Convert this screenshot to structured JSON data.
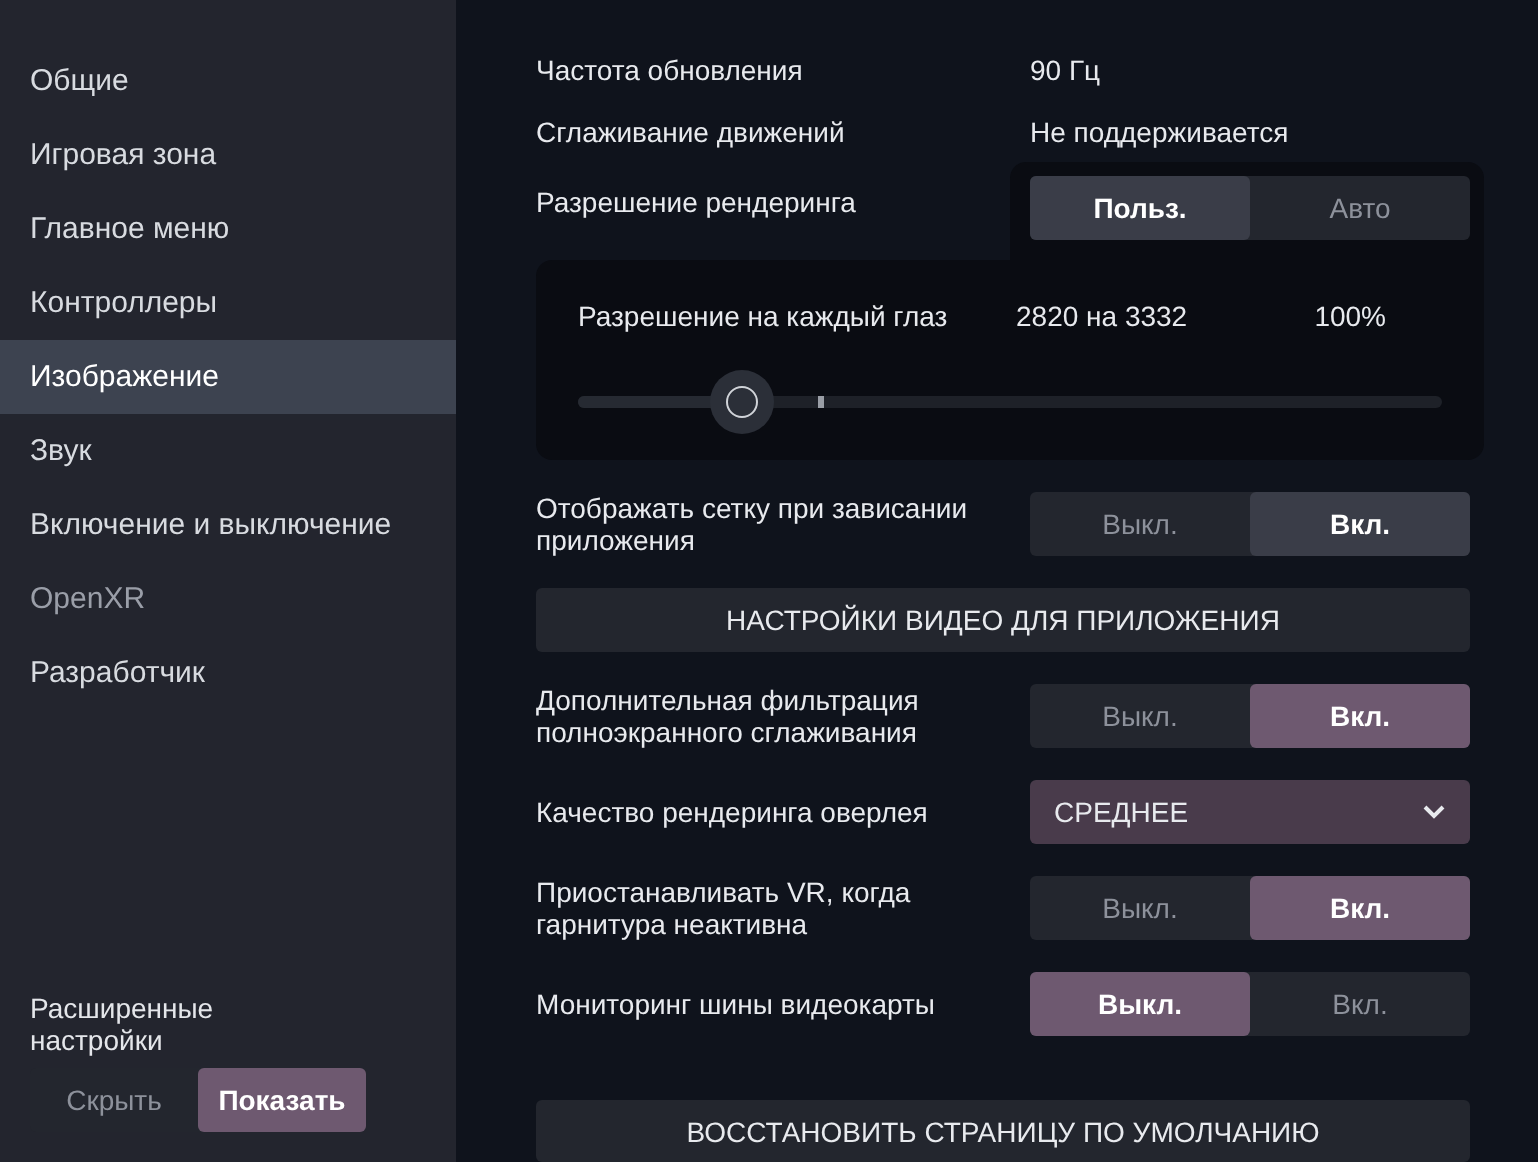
{
  "sidebar": {
    "items": [
      {
        "label": "Общие",
        "selected": false,
        "disabled": false
      },
      {
        "label": "Игровая зона",
        "selected": false,
        "disabled": false
      },
      {
        "label": "Главное меню",
        "selected": false,
        "disabled": false
      },
      {
        "label": "Контроллеры",
        "selected": false,
        "disabled": false
      },
      {
        "label": "Изображение",
        "selected": true,
        "disabled": false
      },
      {
        "label": "Звук",
        "selected": false,
        "disabled": false
      },
      {
        "label": "Включение и выключение",
        "selected": false,
        "disabled": false
      },
      {
        "label": "OpenXR",
        "selected": false,
        "disabled": true
      },
      {
        "label": "Разработчик",
        "selected": false,
        "disabled": false
      }
    ],
    "advanced": {
      "label": "Расширенные настройки",
      "options": [
        {
          "label": "Скрыть",
          "selected": false
        },
        {
          "label": "Показать",
          "selected": true
        }
      ]
    }
  },
  "info_rows": [
    {
      "label": "Частота обновления",
      "value": "90 Гц"
    },
    {
      "label": "Сглаживание движений",
      "value": "Не поддерживается"
    }
  ],
  "render_resolution": {
    "label": "Разрешение рендеринга",
    "options": [
      {
        "label": "Польз.",
        "selected": true
      },
      {
        "label": "Авто",
        "selected": false
      }
    ],
    "per_eye": {
      "label": "Разрешение на каждый глаз",
      "resolution": "2820 на 3332",
      "percent": "100%",
      "level": 0.19
    }
  },
  "settings": [
    {
      "kind": "toggle",
      "accent": false,
      "label": "Отображать сетку при зависании приложения",
      "options": [
        {
          "label": "Выкл.",
          "selected": false
        },
        {
          "label": "Вкл.",
          "selected": true
        }
      ]
    },
    {
      "kind": "header",
      "label": "НАСТРОЙКИ ВИДЕО ДЛЯ ПРИЛОЖЕНИЯ"
    },
    {
      "kind": "toggle",
      "accent": true,
      "label": "Дополнительная фильтрация полноэкранного сглаживания",
      "options": [
        {
          "label": "Выкл.",
          "selected": false
        },
        {
          "label": "Вкл.",
          "selected": true
        }
      ]
    },
    {
      "kind": "dropdown",
      "label": "Качество рендеринга оверлея",
      "value": "СРЕДНЕЕ"
    },
    {
      "kind": "toggle",
      "accent": true,
      "label": "Приостанавливать VR, когда гарнитура неактивна",
      "options": [
        {
          "label": "Выкл.",
          "selected": false
        },
        {
          "label": "Вкл.",
          "selected": true
        }
      ]
    },
    {
      "kind": "toggle",
      "accent": true,
      "label": "Мониторинг шины видеокарты",
      "options": [
        {
          "label": "Выкл.",
          "selected": true
        },
        {
          "label": "Вкл.",
          "selected": false
        }
      ]
    }
  ],
  "restore_button": "ВОССТАНОВИТЬ СТРАНИЦУ ПО УМОЛЧАНИЮ"
}
